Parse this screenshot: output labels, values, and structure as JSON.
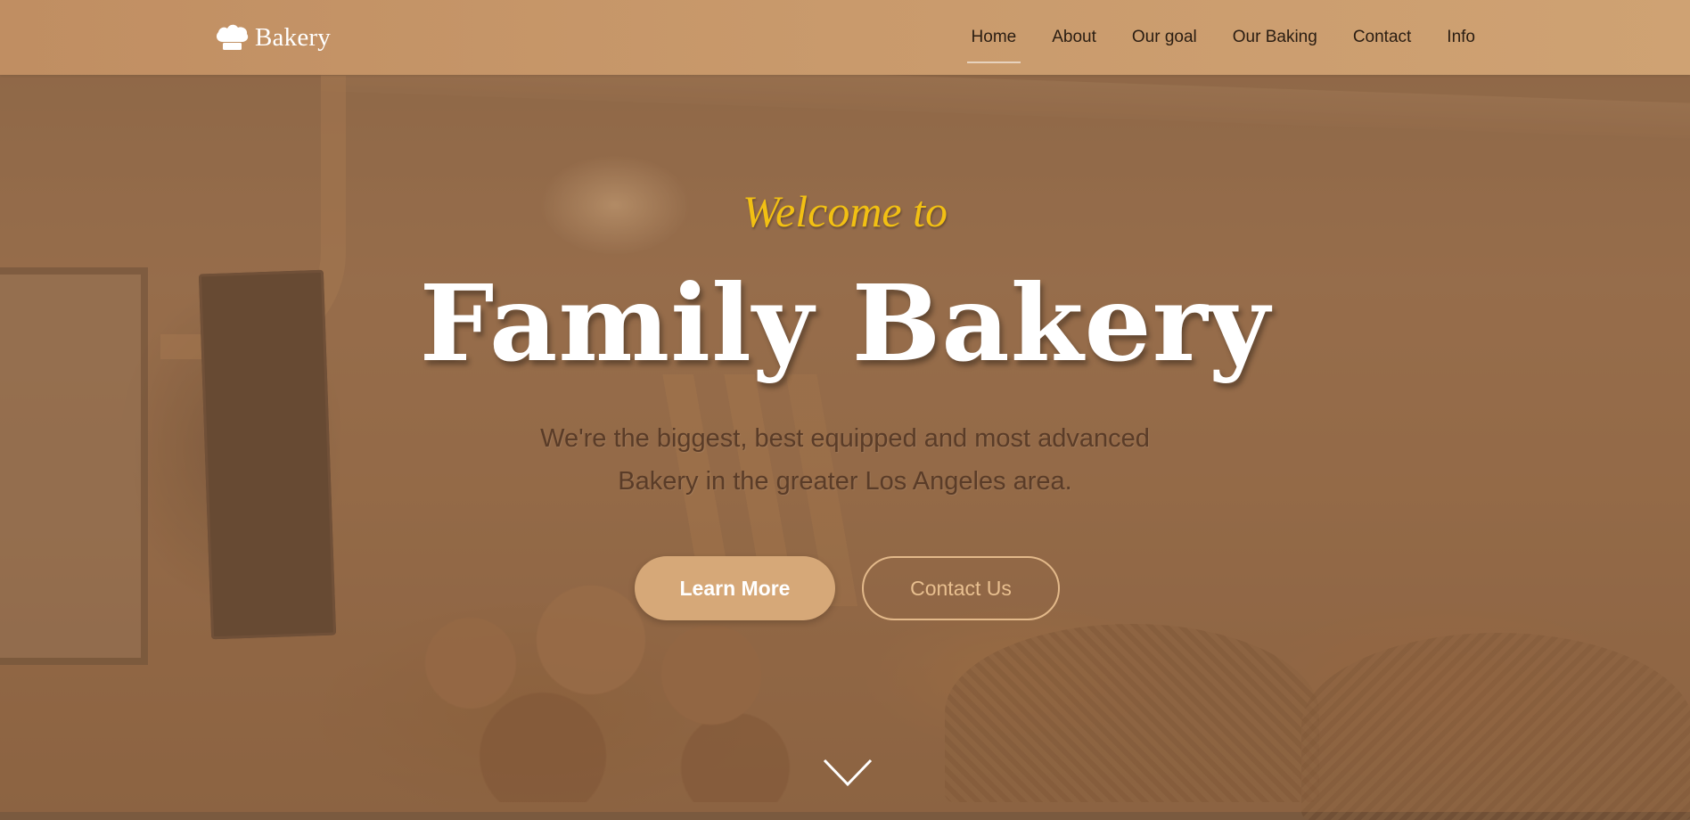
{
  "header": {
    "brand_icon": "chef-hat-icon",
    "brand_text": "Bakery",
    "nav": [
      {
        "label": "Home",
        "active": true
      },
      {
        "label": "About",
        "active": false
      },
      {
        "label": "Our goal",
        "active": false
      },
      {
        "label": "Our Baking",
        "active": false
      },
      {
        "label": "Contact",
        "active": false
      },
      {
        "label": "Info",
        "active": false
      }
    ]
  },
  "hero": {
    "welcome": "Welcome to",
    "title": "Family Bakery",
    "subtitle_line1": "We're the biggest, best equipped and most advanced",
    "subtitle_line2": "Bakery in the greater Los Angeles area.",
    "primary_button": "Learn More",
    "secondary_button": "Contact Us",
    "scroll_icon": "chevron-down-icon"
  },
  "colors": {
    "header_bg": "#c99a6c",
    "accent_yellow": "#f2c013",
    "primary_button": "#d6a878",
    "outline_button": "#e3b98a"
  }
}
